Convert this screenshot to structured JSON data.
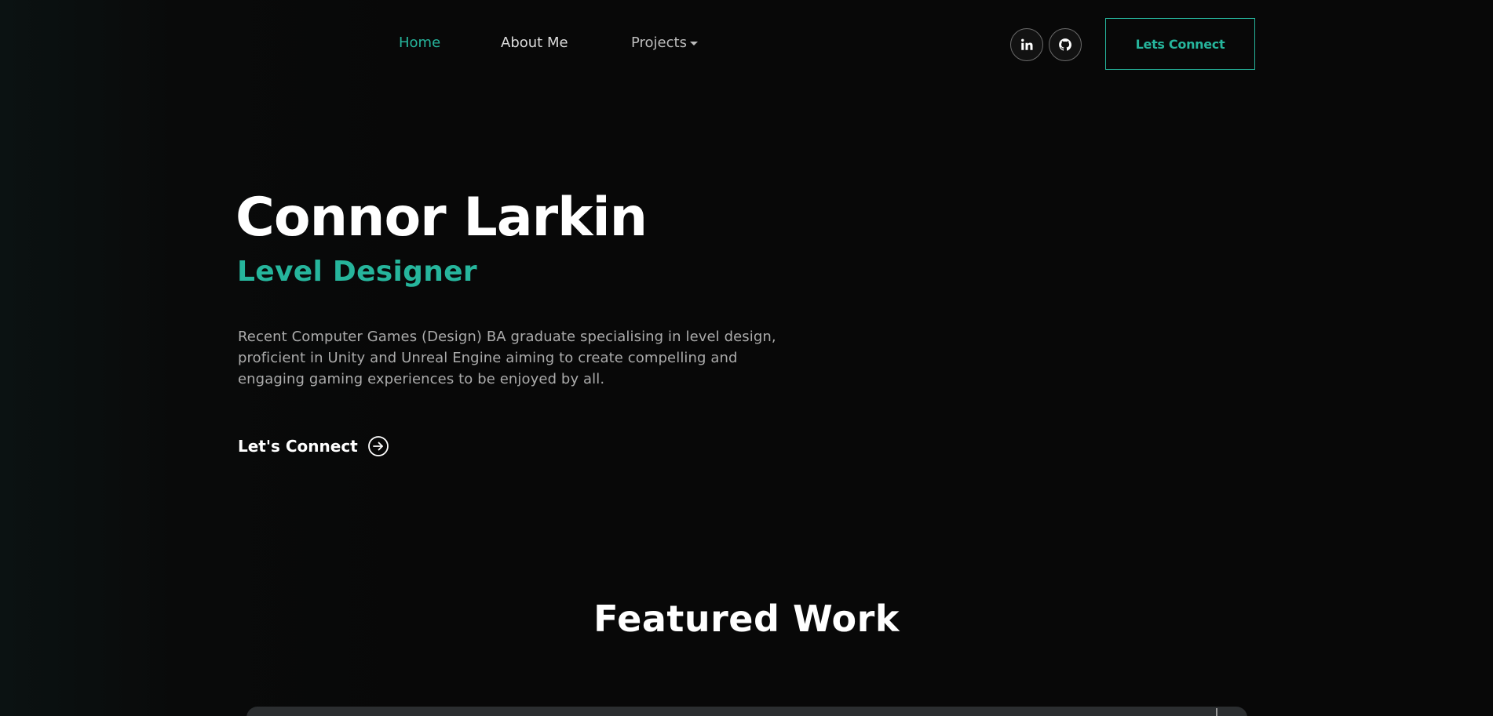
{
  "nav": {
    "links": [
      {
        "label": "Home",
        "active": true
      },
      {
        "label": "About Me",
        "active": false
      },
      {
        "label": "Projects",
        "active": false,
        "has_dropdown": true
      }
    ],
    "social": [
      {
        "icon": "linkedin-icon"
      },
      {
        "icon": "github-icon"
      }
    ],
    "cta_label": "Lets Connect"
  },
  "hero": {
    "name": "Connor Larkin",
    "role": "Level Designer",
    "description": "Recent Computer Games (Design) BA graduate specialising in level design, proficient in Unity and Unreal Engine aiming to create compelling and engaging gaming experiences to be enjoyed by all.",
    "cta_label": "Let's Connect",
    "cta_icon": "arrow-right-circle-icon"
  },
  "featured": {
    "title": "Featured Work"
  },
  "colors": {
    "accent": "#26b59c",
    "background": "#080808",
    "text": "#ffffff",
    "muted": "#ababab"
  }
}
